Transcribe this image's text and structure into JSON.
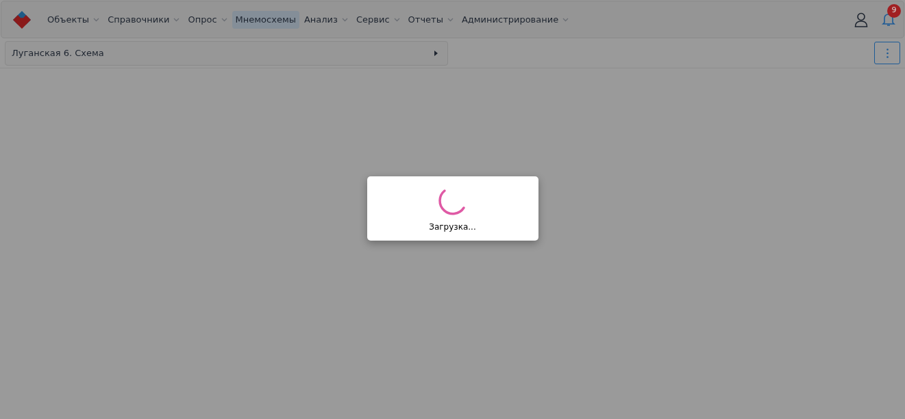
{
  "menu": [
    {
      "label": "Объекты",
      "dropdown": true,
      "selected": false
    },
    {
      "label": "Справочники",
      "dropdown": true,
      "selected": false
    },
    {
      "label": "Опрос",
      "dropdown": true,
      "selected": false
    },
    {
      "label": "Мнемосхемы",
      "dropdown": false,
      "selected": true
    },
    {
      "label": "Анализ",
      "dropdown": true,
      "selected": false
    },
    {
      "label": "Сервис",
      "dropdown": true,
      "selected": false
    },
    {
      "label": "Отчеты",
      "dropdown": true,
      "selected": false
    },
    {
      "label": "Администрирование",
      "dropdown": true,
      "selected": false
    }
  ],
  "notifications": {
    "count": "9"
  },
  "breadcrumb": {
    "title": "Луганская 6. Схема"
  },
  "loading_dialog": {
    "text": "Загрузка..."
  }
}
